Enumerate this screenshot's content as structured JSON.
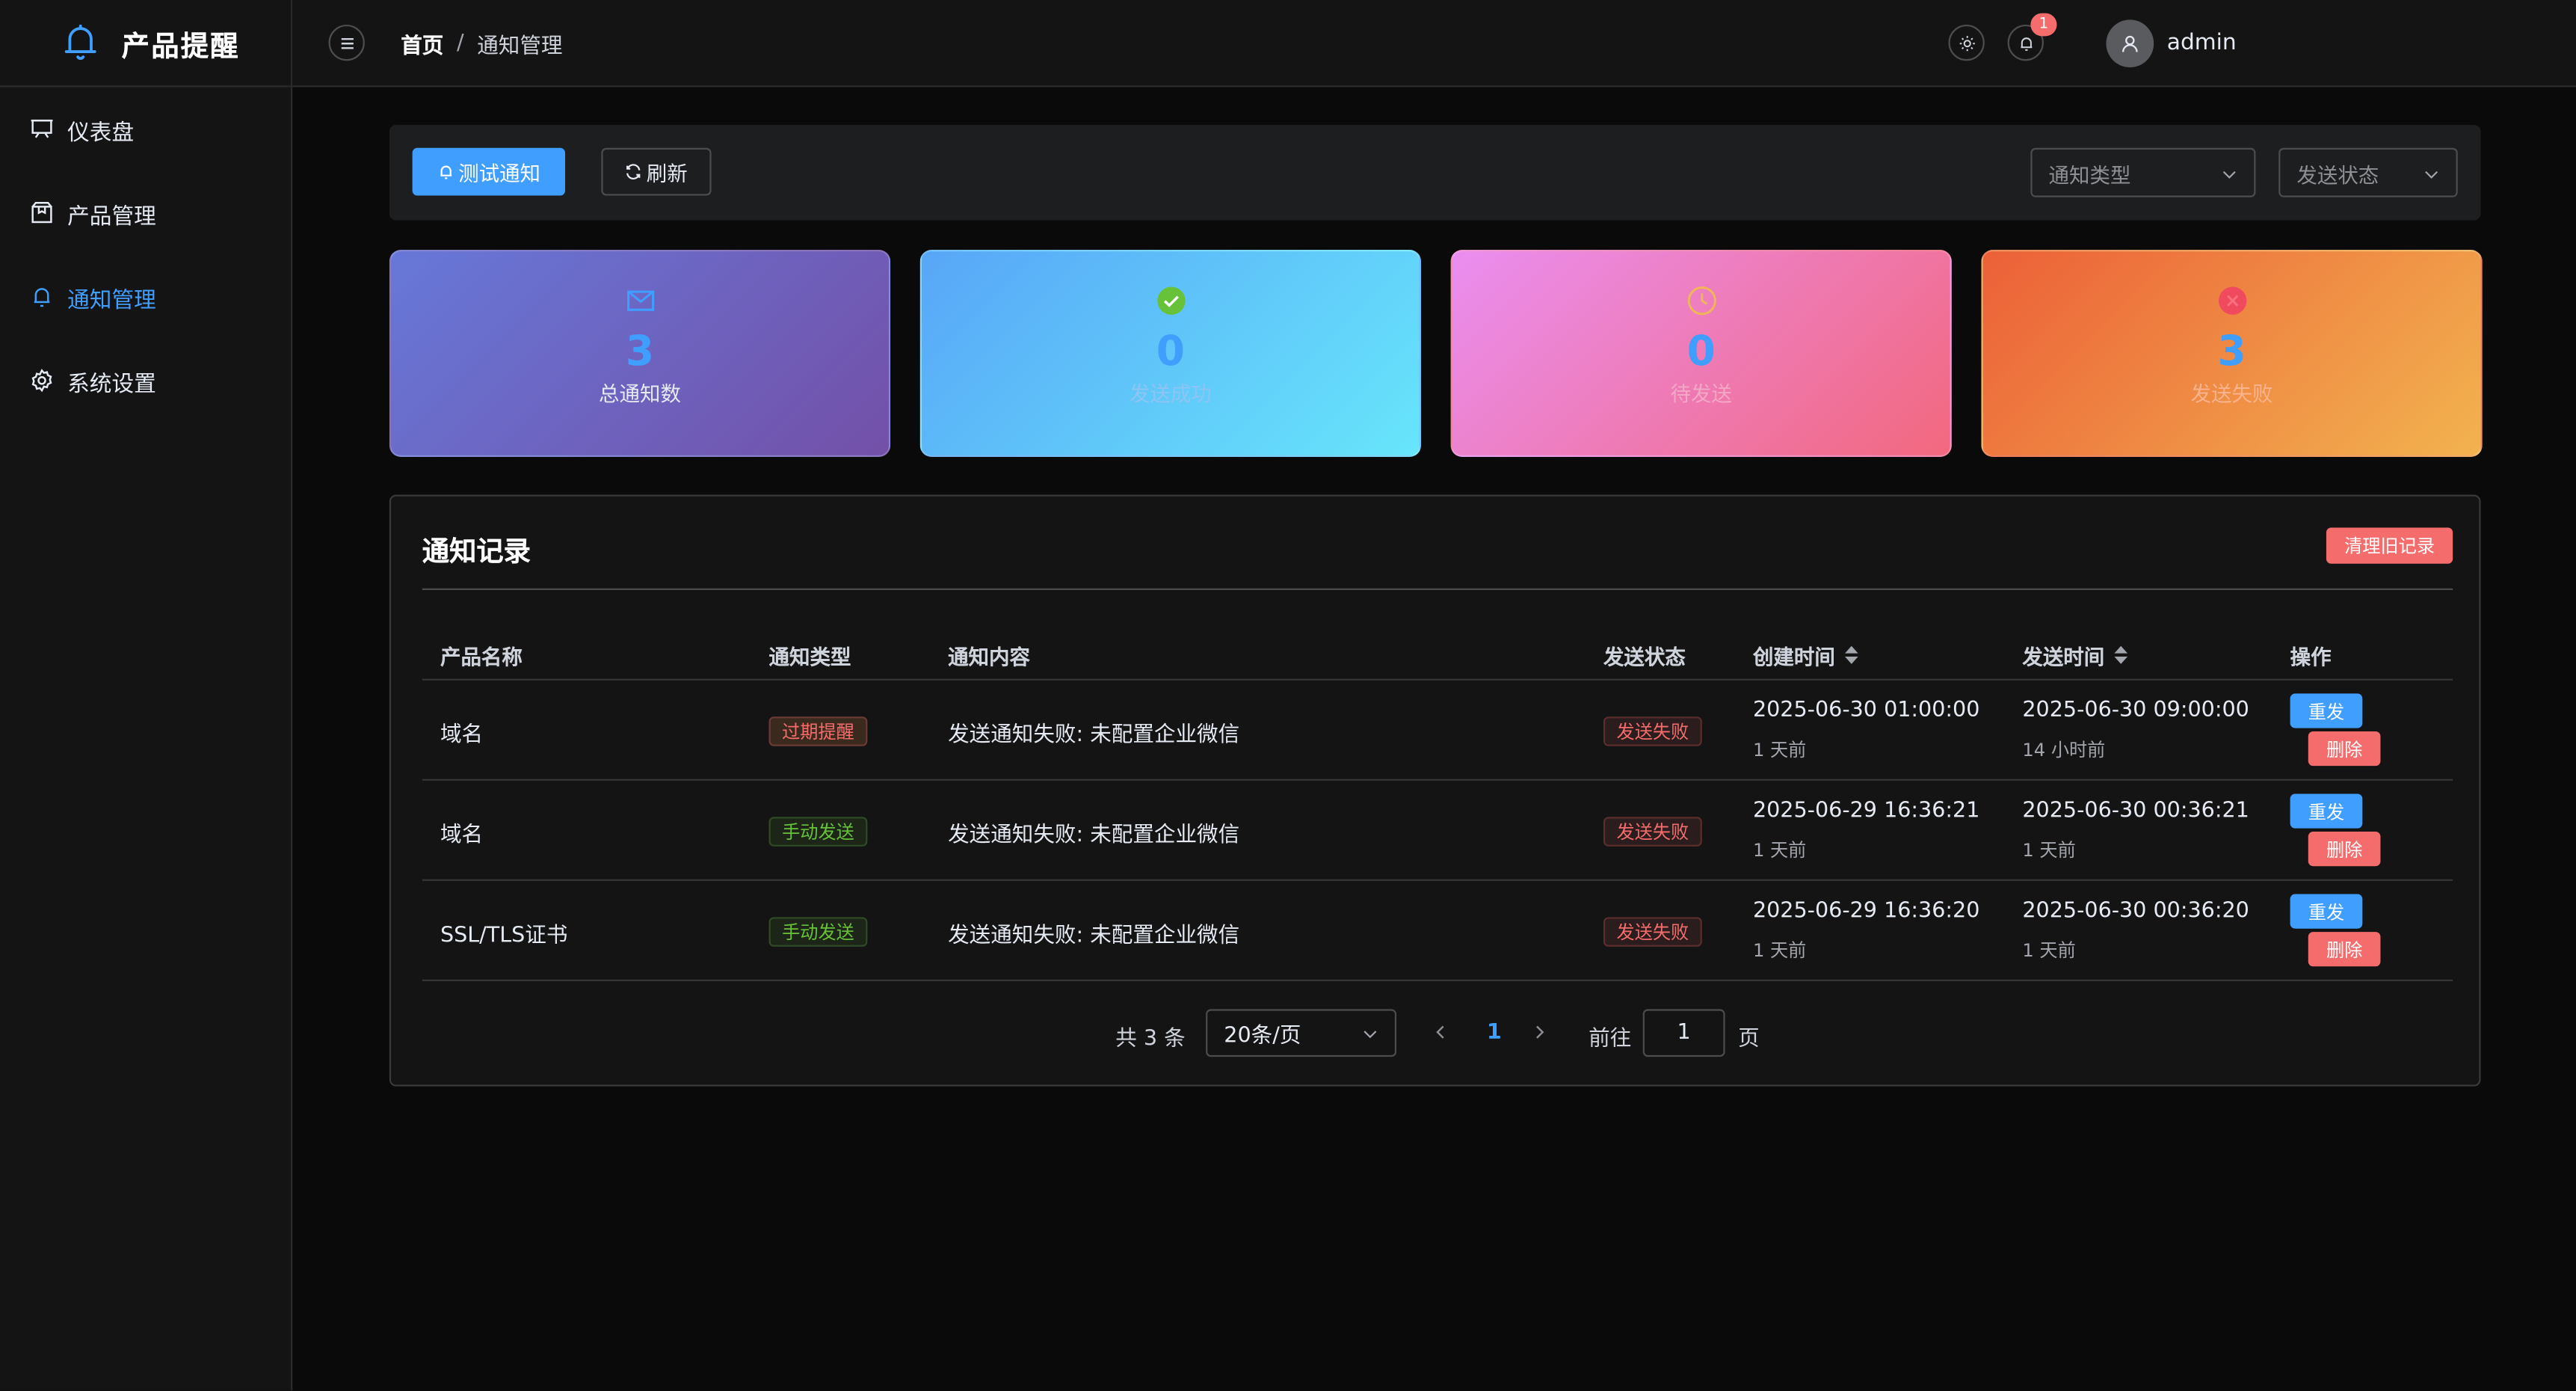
{
  "app": {
    "title": "产品提醒"
  },
  "sidebar": {
    "items": [
      {
        "label": "仪表盘",
        "icon": "dashboard-icon",
        "active": false
      },
      {
        "label": "产品管理",
        "icon": "box-icon",
        "active": false
      },
      {
        "label": "通知管理",
        "icon": "bell-icon",
        "active": true
      },
      {
        "label": "系统设置",
        "icon": "gear-icon",
        "active": false
      }
    ]
  },
  "header": {
    "breadcrumb": {
      "home": "首页",
      "separator": "/",
      "current": "通知管理"
    },
    "notification_count": "1",
    "username": "admin"
  },
  "toolbar": {
    "test_label": "测试通知",
    "refresh_label": "刷新",
    "type_placeholder": "通知类型",
    "status_placeholder": "发送状态"
  },
  "stats": [
    {
      "value": "3",
      "label": "总通知数",
      "icon": "mail-icon"
    },
    {
      "value": "0",
      "label": "发送成功",
      "icon": "check-circle-icon"
    },
    {
      "value": "0",
      "label": "待发送",
      "icon": "clock-icon"
    },
    {
      "value": "3",
      "label": "发送失败",
      "icon": "error-circle-icon"
    }
  ],
  "records": {
    "title": "通知记录",
    "clear_label": "清理旧记录",
    "columns": [
      "产品名称",
      "通知类型",
      "通知内容",
      "发送状态",
      "创建时间",
      "发送时间",
      "操作"
    ],
    "rows": [
      {
        "product": "域名",
        "type": "过期提醒",
        "type_style": "warning",
        "content": "发送通知失败: 未配置企业微信",
        "status": "发送失败",
        "created": "2025-06-30 01:00:00",
        "created_rel": "1 天前",
        "sent": "2025-06-30 09:00:00",
        "sent_rel": "14 小时前",
        "retry": "重发",
        "delete": "删除"
      },
      {
        "product": "域名",
        "type": "手动发送",
        "type_style": "success",
        "content": "发送通知失败: 未配置企业微信",
        "status": "发送失败",
        "created": "2025-06-29 16:36:21",
        "created_rel": "1 天前",
        "sent": "2025-06-30 00:36:21",
        "sent_rel": "1 天前",
        "retry": "重发",
        "delete": "删除"
      },
      {
        "product": "SSL/TLS证书",
        "type": "手动发送",
        "type_style": "success",
        "content": "发送通知失败: 未配置企业微信",
        "status": "发送失败",
        "created": "2025-06-29 16:36:20",
        "created_rel": "1 天前",
        "sent": "2025-06-30 00:36:20",
        "sent_rel": "1 天前",
        "retry": "重发",
        "delete": "删除"
      }
    ]
  },
  "pagination": {
    "total_text": "共 3 条",
    "page_size": "20条/页",
    "current_page": "1",
    "goto_label": "前往",
    "goto_value": "1",
    "page_suffix": "页"
  },
  "colors": {
    "primary": "#409eff",
    "danger": "#f56c6c",
    "success": "#67c23a",
    "background": "#0a0a0a",
    "panel": "#141414"
  }
}
